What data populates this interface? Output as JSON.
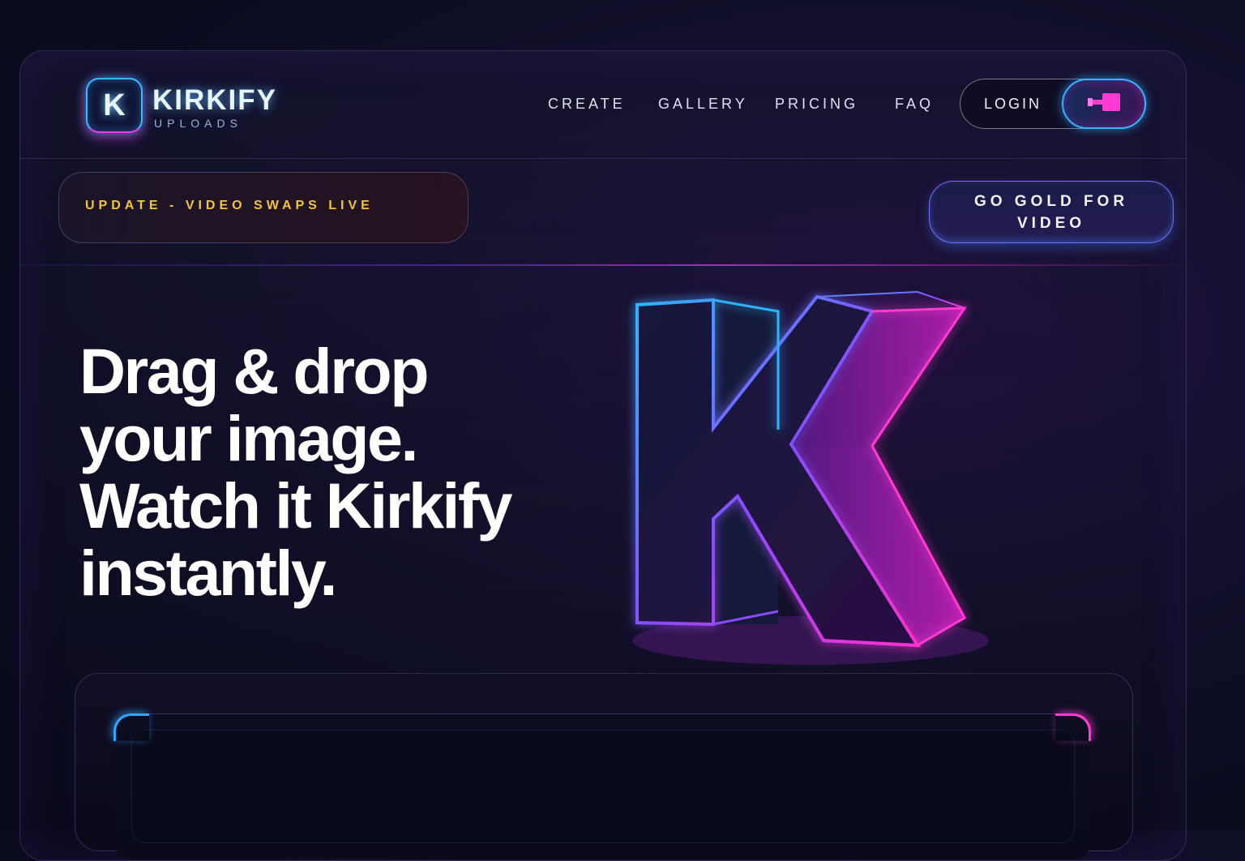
{
  "brand": {
    "logo_letter": "K",
    "title": "KIRKIFY",
    "subtitle": "UPLOADS"
  },
  "nav": {
    "items": [
      {
        "label": "CREATE"
      },
      {
        "label": "GALLERY"
      },
      {
        "label": "PRICING"
      },
      {
        "label": "FAQ"
      }
    ],
    "login_label": "LOGIN"
  },
  "banner": {
    "update_text": "UPDATE - VIDEO SWAPS LIVE",
    "cta_label": "GO GOLD FOR VIDEO"
  },
  "hero": {
    "lines": [
      "Drag & drop",
      "your image.",
      "Watch it Kirkify",
      "instantly."
    ],
    "art_icon": "neon-k-letter-icon"
  },
  "colors": {
    "accent_blue": "#35b6ff",
    "accent_magenta": "#ff3bd2",
    "update_gold": "#f2c53a"
  }
}
